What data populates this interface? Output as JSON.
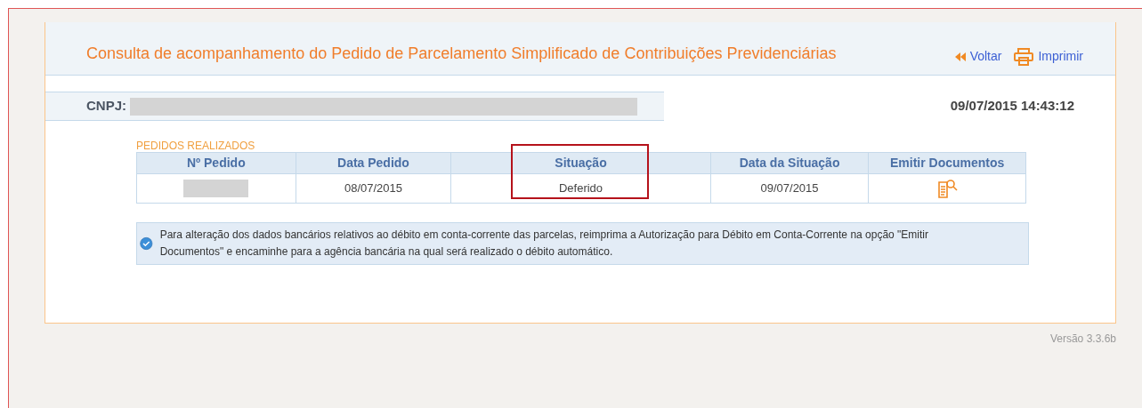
{
  "header": {
    "title": "Consulta de acompanhamento do Pedido de Parcelamento Simplificado de Contribuições Previdenciárias",
    "links": [
      {
        "kind": "back",
        "label": "Voltar"
      },
      {
        "kind": "print",
        "label": "Imprimir"
      }
    ]
  },
  "cnpj": {
    "label": "CNPJ:"
  },
  "timestamp": "09/07/2015 14:43:12",
  "orders": {
    "title": "PEDIDOS REALIZADOS",
    "columns": [
      {
        "label": "Nº Pedido",
        "highlighted": false
      },
      {
        "label": "Data Pedido",
        "highlighted": false
      },
      {
        "label": "Situação",
        "highlighted": true
      },
      {
        "label": "Data da Situação",
        "highlighted": false
      },
      {
        "label": "Emitir Documentos",
        "highlighted": false
      }
    ],
    "rows": [
      {
        "data_pedido": "08/07/2015",
        "situacao": "Deferido",
        "data_situacao": "09/07/2015"
      }
    ]
  },
  "info": "Para alteração dos dados bancários relativos ao débito em conta-corrente das parcelas, reimprima a Autorização para Débito em Conta-Corrente na opção \"Emitir Documentos\" e encaminhe para a agência bancária na qual será realizado o débito automático.",
  "version": "Versão 3.3.6b"
}
